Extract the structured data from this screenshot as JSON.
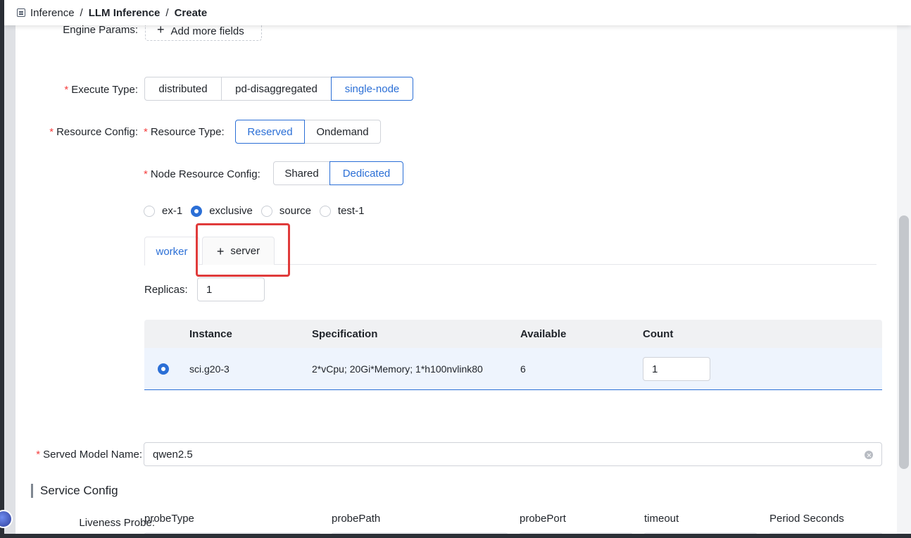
{
  "breadcrumb": {
    "items": [
      "Inference",
      "LLM Inference"
    ],
    "current": "Create",
    "separator": "/"
  },
  "form": {
    "engine_params": {
      "label": "Engine Params",
      "add_button_label": "Add more fields"
    },
    "execute_type": {
      "label": "Execute Type",
      "options": [
        "distributed",
        "pd-disaggregated",
        "single-node"
      ],
      "selected": "single-node"
    },
    "resource_config": {
      "label": "Resource Config",
      "resource_type": {
        "label": "Resource Type",
        "options": [
          "Reserved",
          "Ondemand"
        ],
        "selected": "Reserved"
      },
      "node_resource_config": {
        "label": "Node Resource Config",
        "options": [
          "Shared",
          "Dedicated"
        ],
        "selected": "Dedicated"
      },
      "pools": {
        "options": [
          "ex-1",
          "exclusive",
          "source",
          "test-1"
        ],
        "selected": "exclusive"
      },
      "tabs": {
        "active": "worker",
        "add_label": "server"
      },
      "replicas": {
        "label": "Replicas",
        "value": "1"
      },
      "instance_table": {
        "columns": [
          "Instance",
          "Specification",
          "Available",
          "Count"
        ],
        "rows": [
          {
            "instance": "sci.g20-3",
            "specification": "2*vCpu; 20Gi*Memory; 1*h100nvlink80",
            "available": "6",
            "count": "1",
            "selected": true
          }
        ]
      }
    },
    "served_model_name": {
      "label": "Served Model Name",
      "value": "qwen2.5"
    }
  },
  "service_config": {
    "title": "Service Config",
    "liveness_probe": {
      "label": "Liveness Probe",
      "columns": [
        "probeType",
        "probePath",
        "probePort",
        "timeout",
        "Period Seconds"
      ]
    }
  },
  "colors": {
    "accent": "#2b6fd6",
    "required": "#f53f3f",
    "highlight_box": "#e03b3b"
  }
}
